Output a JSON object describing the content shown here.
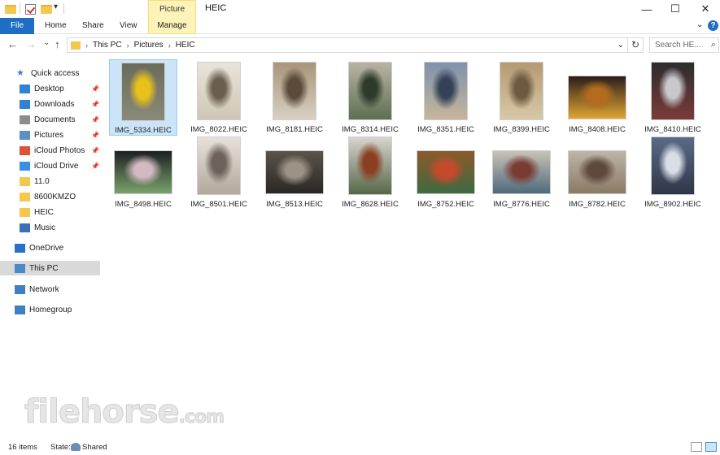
{
  "window": {
    "title": "HEIC",
    "picture_tools": "Picture Tools",
    "controls": {
      "minimize": "—",
      "maximize": "☐",
      "close": "✕"
    }
  },
  "quick_access_toolbar": {
    "dropdown": "▾"
  },
  "ribbon": {
    "tabs": [
      "File",
      "Home",
      "Share",
      "View",
      "Manage"
    ],
    "collapse_chevron": "⌄",
    "help": "?"
  },
  "address": {
    "back": "←",
    "forward": "→",
    "recent": "⌄",
    "up": "↑",
    "crumbs": [
      "This PC",
      "Pictures",
      "HEIC"
    ],
    "dropdown": "⌄",
    "refresh": "↻",
    "search_placeholder": "Search HE...",
    "search_icon": "⌕"
  },
  "sidebar": {
    "items": [
      {
        "label": "Quick access",
        "icon": "star-icon",
        "pinned": false
      },
      {
        "label": "Desktop",
        "icon": "desktop-icon",
        "pinned": true
      },
      {
        "label": "Downloads",
        "icon": "downloads-icon",
        "pinned": true
      },
      {
        "label": "Documents",
        "icon": "documents-icon",
        "pinned": true
      },
      {
        "label": "Pictures",
        "icon": "pictures-icon",
        "pinned": true
      },
      {
        "label": "iCloud Photos",
        "icon": "icloud-photos-icon",
        "pinned": true
      },
      {
        "label": "iCloud Drive",
        "icon": "icloud-drive-icon",
        "pinned": true
      },
      {
        "label": "11.0",
        "icon": "folder-icon",
        "pinned": false
      },
      {
        "label": "8600KMZO",
        "icon": "folder-icon",
        "pinned": false
      },
      {
        "label": "HEIC",
        "icon": "folder-icon",
        "pinned": false
      },
      {
        "label": "Music",
        "icon": "music-icon",
        "pinned": false
      },
      {
        "label": "OneDrive",
        "icon": "onedrive-icon",
        "pinned": false
      },
      {
        "label": "This PC",
        "icon": "this-pc-icon",
        "pinned": false
      },
      {
        "label": "Network",
        "icon": "network-icon",
        "pinned": false
      },
      {
        "label": "Homegroup",
        "icon": "homegroup-icon",
        "pinned": false
      }
    ],
    "pin_glyph": "📌"
  },
  "files": [
    {
      "name": "IMG_5334.HEIC",
      "colors": [
        "#6b6b5c",
        "#e8c21a",
        "#8a8a78"
      ]
    },
    {
      "name": "IMG_8022.HEIC",
      "colors": [
        "#e9e4da",
        "#6a5e50",
        "#cfc6b5"
      ]
    },
    {
      "name": "IMG_8181.HEIC",
      "colors": [
        "#a8957a",
        "#5b4a3a",
        "#d8d0c2"
      ]
    },
    {
      "name": "IMG_8314.HEIC",
      "colors": [
        "#b9b3a4",
        "#2e3a2a",
        "#5d6f52"
      ]
    },
    {
      "name": "IMG_8351.HEIC",
      "colors": [
        "#7e92ad",
        "#334256",
        "#c7b69a"
      ]
    },
    {
      "name": "IMG_8399.HEIC",
      "colors": [
        "#b59a72",
        "#6d5a40",
        "#d7c8a8"
      ]
    },
    {
      "name": "IMG_8408.HEIC",
      "colors": [
        "#2b1d1a",
        "#b36b1e",
        "#e0a634"
      ]
    },
    {
      "name": "IMG_8410.HEIC",
      "colors": [
        "#2c2c2e",
        "#c9c9cc",
        "#7a3c3a"
      ]
    },
    {
      "name": "IMG_8498.HEIC",
      "colors": [
        "#1e2022",
        "#d2b9c3",
        "#79a36b"
      ]
    },
    {
      "name": "IMG_8501.HEIC",
      "colors": [
        "#e6e1da",
        "#6c6259",
        "#b3a99c"
      ]
    },
    {
      "name": "IMG_8513.HEIC",
      "colors": [
        "#5a544a",
        "#9c9285",
        "#2a2724"
      ]
    },
    {
      "name": "IMG_8628.HEIC",
      "colors": [
        "#d7d4cf",
        "#8a3f22",
        "#566848"
      ]
    },
    {
      "name": "IMG_8752.HEIC",
      "colors": [
        "#8b5a2b",
        "#c44a2c",
        "#3f6a42"
      ]
    },
    {
      "name": "IMG_8776.HEIC",
      "colors": [
        "#c9c3b6",
        "#7a3b32",
        "#4e6a7c"
      ]
    },
    {
      "name": "IMG_8782.HEIC",
      "colors": [
        "#bdb5a6",
        "#5d4a3c",
        "#8a7a66"
      ]
    },
    {
      "name": "IMG_8902.HEIC",
      "colors": [
        "#5a6b86",
        "#d9dee6",
        "#2e3646"
      ]
    }
  ],
  "status": {
    "item_count": "16 items",
    "state_label": "State:",
    "state_value": "Shared"
  },
  "watermark": {
    "main": "filehorse",
    "suffix": ".com"
  }
}
